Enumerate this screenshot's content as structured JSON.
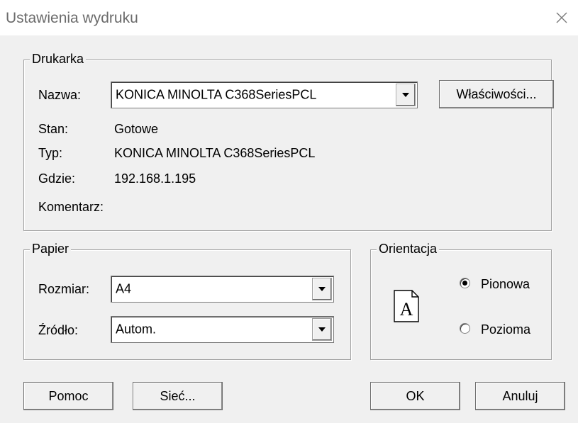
{
  "window": {
    "title": "Ustawienia wydruku"
  },
  "printer_group": {
    "legend": "Drukarka",
    "name_label": "Nazwa:",
    "name_value": "KONICA MINOLTA C368SeriesPCL",
    "properties_button": "Właściwości...",
    "status_label": "Stan:",
    "status_value": "Gotowe",
    "type_label": "Typ:",
    "type_value": "KONICA MINOLTA C368SeriesPCL",
    "where_label": "Gdzie:",
    "where_value": "192.168.1.195",
    "comment_label": "Komentarz:",
    "comment_value": ""
  },
  "paper_group": {
    "legend": "Papier",
    "size_label": "Rozmiar:",
    "size_value": "A4",
    "source_label": "Źródło:",
    "source_value": "Autom."
  },
  "orientation_group": {
    "legend": "Orientacja",
    "page_glyph": "A",
    "portrait_label": "Pionowa",
    "landscape_label": "Pozioma",
    "selected": "portrait"
  },
  "buttons": {
    "help": "Pomoc",
    "network": "Sieć...",
    "ok": "OK",
    "cancel": "Anuluj"
  },
  "icons": {
    "close": "close-icon",
    "dropdown": "chevron-down-icon",
    "orientation_preview": "page-portrait-icon"
  }
}
